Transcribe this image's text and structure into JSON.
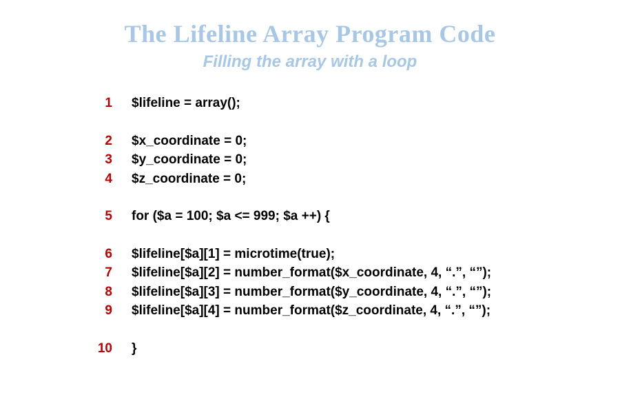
{
  "title": "The Lifeline Array Program Code",
  "subtitle": "Filling the array with a loop",
  "code": {
    "lines": [
      {
        "num": "1",
        "text": "$lifeline = array();"
      },
      {
        "num": "2",
        "text": "$x_coordinate = 0;"
      },
      {
        "num": "3",
        "text": "$y_coordinate = 0;"
      },
      {
        "num": "4",
        "text": "$z_coordinate = 0;"
      },
      {
        "num": "5",
        "text": "for ($a = 100; $a <= 999; $a ++) {"
      },
      {
        "num": "6",
        "text": "$lifeline[$a][1] = microtime(true);"
      },
      {
        "num": "7",
        "text": "$lifeline[$a][2] = number_format($x_coordinate, 4, “.”, “”);"
      },
      {
        "num": "8",
        "text": "$lifeline[$a][3] = number_format($y_coordinate, 4, “.”, “”);"
      },
      {
        "num": "9",
        "text": "$lifeline[$a][4] = number_format($z_coordinate, 4, “.”, “”);"
      },
      {
        "num": "10",
        "text": "}"
      }
    ]
  }
}
